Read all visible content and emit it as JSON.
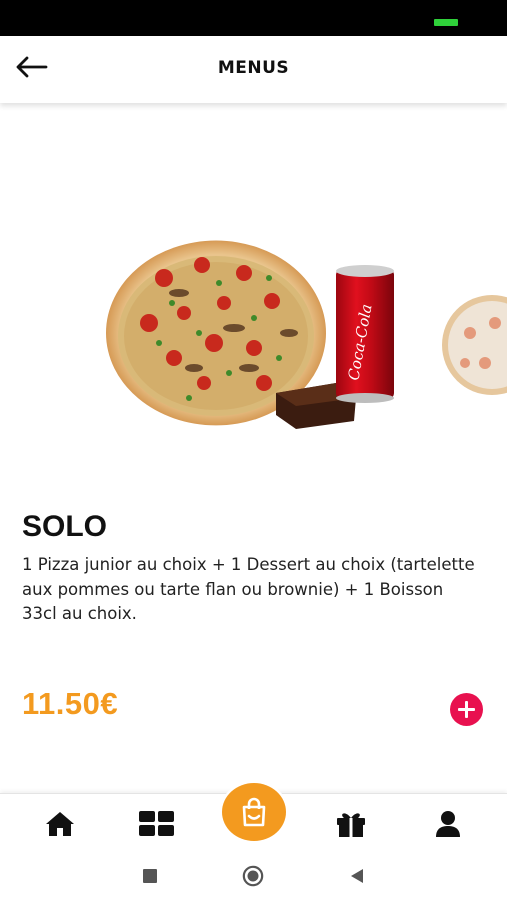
{
  "status_bar": {
    "battery_color": "#2fd13a"
  },
  "header": {
    "title": "MENUS",
    "back_icon": "arrow-left-icon"
  },
  "menu_item": {
    "name": "SOLO",
    "description": "1 Pizza junior au choix + 1 Dessert au choix (tartelette aux pommes ou tarte flan ou brownie) + 1 Boisson 33cl au choix.",
    "price": "11.50€",
    "can_brand": "Coca-Cola",
    "add_icon": "plus-circle-icon"
  },
  "bottom_nav": {
    "items": [
      {
        "icon": "home-icon"
      },
      {
        "icon": "grid-icon"
      },
      {
        "icon": "shopping-bag-icon"
      },
      {
        "icon": "gift-icon"
      },
      {
        "icon": "user-icon"
      }
    ]
  },
  "system_nav": {
    "items": [
      {
        "icon": "recents-square-icon"
      },
      {
        "icon": "home-circle-icon"
      },
      {
        "icon": "back-triangle-icon"
      }
    ]
  },
  "colors": {
    "accent_orange": "#f39a1f",
    "add_button_red": "#e8114f",
    "text_dark": "#111111"
  }
}
